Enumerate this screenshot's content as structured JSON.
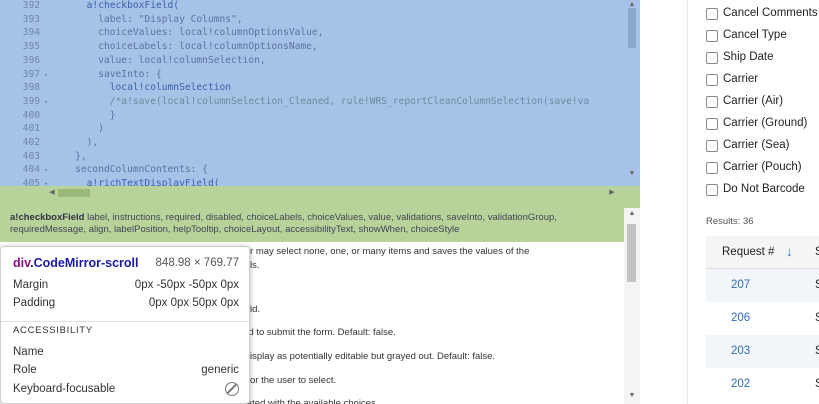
{
  "editor": {
    "code_lines": [
      {
        "num": "392",
        "fold": "",
        "text": "      a!checkboxField(",
        "kind": "fn"
      },
      {
        "num": "393",
        "fold": "",
        "text": "        label: \"Display Columns\",",
        "kind": ""
      },
      {
        "num": "394",
        "fold": "",
        "text": "        choiceValues: local!columnOptionsValue,",
        "kind": ""
      },
      {
        "num": "395",
        "fold": "",
        "text": "        choiceLabels: local!columnOptionsName,",
        "kind": ""
      },
      {
        "num": "396",
        "fold": "",
        "text": "        value: local!columnSelection,",
        "kind": ""
      },
      {
        "num": "397",
        "fold": "▾",
        "text": "        saveInto: {",
        "kind": ""
      },
      {
        "num": "398",
        "fold": "",
        "text": "          local!columnSelection",
        "kind": "fn"
      },
      {
        "num": "399",
        "fold": "▾",
        "text": "          /*a!save(local!columnSelection_Cleaned, rule!WRS_reportCleanColumnSelection(save!va",
        "kind": "comment"
      },
      {
        "num": "400",
        "fold": "",
        "text": "          }",
        "kind": ""
      },
      {
        "num": "401",
        "fold": "",
        "text": "        )",
        "kind": ""
      },
      {
        "num": "402",
        "fold": "",
        "text": "      ),",
        "kind": ""
      },
      {
        "num": "403",
        "fold": "",
        "text": "    },",
        "kind": ""
      },
      {
        "num": "404",
        "fold": "▾",
        "text": "    secondColumnContents: {",
        "kind": ""
      },
      {
        "num": "405",
        "fold": "▾",
        "text": "      a!richTextDisplayField(",
        "kind": "fn"
      }
    ],
    "signature_fn": "a!checkboxField",
    "signature_params": " label, instructions, required, disabled, choiceLabels, choiceValues, value, validations, saveInto, validationGroup, requiredMessage, align, labelPosition, helpTooltip, choiceLayout, accessibilityText, showWhen, choiceStyle",
    "doc_lines": [
      "ser may select none, one, or many items and saves the values of the",
      "tails.",
      "field.",
      "red to submit the form. Default: false.",
      "l display as potentially editable but grayed out. Default: false.",
      "s for the user to select.",
      "ciated with the available choices."
    ]
  },
  "tooltip": {
    "element": "div",
    "class_name": ".CodeMirror-scroll",
    "size": "848.98 × 769.77",
    "margin_label": "Margin",
    "margin_value": "0px -50px -50px 0px",
    "padding_label": "Padding",
    "padding_value": "0px 0px 50px 0px",
    "accessibility_title": "ACCESSIBILITY",
    "name_label": "Name",
    "name_value": "",
    "role_label": "Role",
    "role_value": "generic",
    "focusable_label": "Keyboard-focusable",
    "focusable_icon": "no-entry-icon"
  },
  "app": {
    "checkboxes": [
      {
        "label": "Cancel Comments",
        "checked": false
      },
      {
        "label": "Cancel Type",
        "checked": false
      },
      {
        "label": "Ship Date",
        "checked": false
      },
      {
        "label": "Carrier",
        "checked": false
      },
      {
        "label": "Carrier (Air)",
        "checked": false
      },
      {
        "label": "Carrier (Ground)",
        "checked": false
      },
      {
        "label": "Carrier (Sea)",
        "checked": false
      },
      {
        "label": "Carrier (Pouch)",
        "checked": false
      },
      {
        "label": "Do Not Barcode",
        "checked": false
      }
    ],
    "results_text": "Results: 36",
    "grid": {
      "header_request": "Request #",
      "sort_icon": "arrow-down-icon",
      "sort_glyph": "↓",
      "header_next": "S",
      "rows": [
        {
          "id": "207",
          "next": "Sc"
        },
        {
          "id": "206",
          "next": "Sc"
        },
        {
          "id": "203",
          "next": "Sc"
        },
        {
          "id": "202",
          "next": "Sc"
        }
      ]
    },
    "colors": {
      "link": "#2f6db5",
      "highlight_blue": "#a6c2e6",
      "highlight_green": "#b7d39a"
    }
  }
}
